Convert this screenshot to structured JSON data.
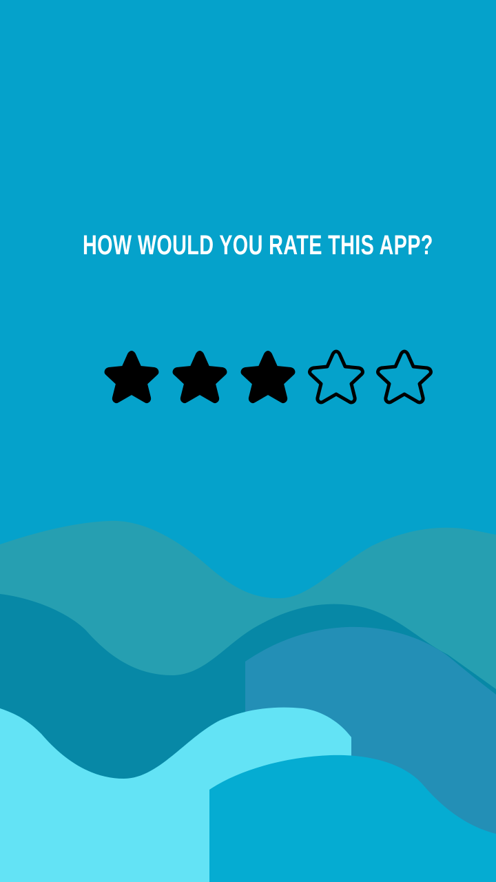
{
  "screen": {
    "question": "HOW WOULD YOU RATE THIS APP?"
  },
  "rating": {
    "value": 3,
    "max": 5,
    "filled_color": "#000000",
    "empty_color": "transparent",
    "outline_color": "#000000"
  },
  "colors": {
    "background": "#05A2CB",
    "text": "#FFFFFF",
    "wave_teal": "#269FB1",
    "wave_dark": "#0788A6",
    "wave_blue": "#238FB6",
    "wave_light": "#63E3F5",
    "wave_front": "#05ACD2"
  },
  "icons": {
    "star": "star-icon"
  }
}
